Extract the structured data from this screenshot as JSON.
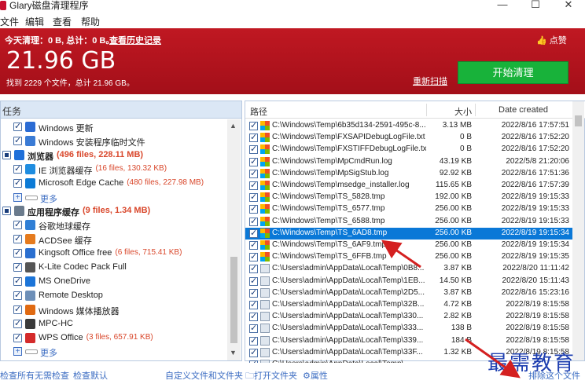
{
  "window": {
    "title": "Glary磁盘清理程序",
    "min_glyph": "—",
    "max_glyph": "☐",
    "close_glyph": "✕"
  },
  "menu": [
    "文件",
    "编辑",
    "查看",
    "帮助"
  ],
  "header": {
    "summary": "今天清理：0 B, 总计：0 B。",
    "history_link": "查看历史记录",
    "big_size": "21.96 GB",
    "found": "找到 2229 个文件，总计 21.96 GB。",
    "like": "点赞",
    "rescan": "重新扫描",
    "start_button": "开始清理"
  },
  "left_pane": {
    "header": "任务",
    "rows": [
      {
        "label": "Windows 更新",
        "count": "",
        "icon": "windows-icon",
        "color": "#2b6cd4",
        "indent": 1
      },
      {
        "label": "Windows 安装程序临时文件",
        "count": "",
        "icon": "windows-installer-icon",
        "color": "#3a7bd5",
        "indent": 1
      },
      {
        "label": "浏览器",
        "count": "(496 files, 228.11 MB)",
        "icon": "browser-icon",
        "color": "#1e6fd9",
        "indent": 0,
        "bold": true
      },
      {
        "label": "IE 浏览器缓存",
        "count": "(16 files, 130.32 KB)",
        "icon": "ie-icon",
        "color": "#1f8de0",
        "indent": 1
      },
      {
        "label": "Microsoft Edge Cache",
        "count": "(480 files, 227.98 MB)",
        "icon": "edge-icon",
        "color": "#0c7bd6",
        "indent": 1
      },
      {
        "label": "更多",
        "more": true,
        "indent": 1
      },
      {
        "label": "应用程序缓存",
        "count": "(9 files, 1.34 MB)",
        "icon": "apps-icon",
        "color": "#6b7b8c",
        "indent": 0,
        "bold": true
      },
      {
        "label": "谷歌地球缓存",
        "count": "",
        "icon": "google-earth-icon",
        "color": "#2f7fd6",
        "indent": 1
      },
      {
        "label": "ACDSee 缓存",
        "count": "",
        "icon": "acdsee-icon",
        "color": "#e57b1e",
        "indent": 1
      },
      {
        "label": "Kingsoft Office free",
        "count": "(6 files, 715.41 KB)",
        "icon": "kingsoft-icon",
        "color": "#2a6fd0",
        "indent": 1
      },
      {
        "label": "K-Lite Codec Pack Full",
        "count": "",
        "icon": "klite-icon",
        "color": "#555555",
        "indent": 1
      },
      {
        "label": "MS OneDrive",
        "count": "",
        "icon": "onedrive-icon",
        "color": "#1b74d8",
        "indent": 1
      },
      {
        "label": "Remote Desktop",
        "count": "",
        "icon": "remote-desktop-icon",
        "color": "#6d8fb8",
        "indent": 1
      },
      {
        "label": "Windows 媒体播放器",
        "count": "",
        "icon": "media-player-icon",
        "color": "#e06a12",
        "indent": 1
      },
      {
        "label": "MPC-HC",
        "count": "",
        "icon": "mpc-hc-icon",
        "color": "#3a3a3a",
        "indent": 1
      },
      {
        "label": "WPS Office",
        "count": "(3 files, 657.91 KB)",
        "icon": "wps-icon",
        "color": "#d42b2b",
        "indent": 1
      },
      {
        "label": "更多",
        "more": true,
        "indent": 1
      }
    ],
    "scroll_up": "▲",
    "scroll_down": "▼"
  },
  "right_pane": {
    "columns": {
      "path": "路径",
      "size": "大小",
      "date": "Date created"
    },
    "files": [
      {
        "path": "C:\\Windows\\Temp\\6b35d134-2591-495c-8...",
        "size": "3.13 MB",
        "date": "2022/8/16 17:57:51"
      },
      {
        "path": "C:\\Windows\\Temp\\FXSAPIDebugLogFile.txt",
        "size": "0 B",
        "date": "2022/8/16 17:52:20"
      },
      {
        "path": "C:\\Windows\\Temp\\FXSTIFFDebugLogFile.txt",
        "size": "0 B",
        "date": "2022/8/16 17:52:20"
      },
      {
        "path": "C:\\Windows\\Temp\\MpCmdRun.log",
        "size": "43.19 KB",
        "date": "2022/5/8 21:20:06"
      },
      {
        "path": "C:\\Windows\\Temp\\MpSigStub.log",
        "size": "92.92 KB",
        "date": "2022/8/16 17:51:36"
      },
      {
        "path": "C:\\Windows\\Temp\\msedge_installer.log",
        "size": "115.65 KB",
        "date": "2022/8/16 17:57:39"
      },
      {
        "path": "C:\\Windows\\Temp\\TS_5828.tmp",
        "size": "192.00 KB",
        "date": "2022/8/19 19:15:33"
      },
      {
        "path": "C:\\Windows\\Temp\\TS_6577.tmp",
        "size": "256.00 KB",
        "date": "2022/8/19 19:15:33"
      },
      {
        "path": "C:\\Windows\\Temp\\TS_6588.tmp",
        "size": "256.00 KB",
        "date": "2022/8/19 19:15:33"
      },
      {
        "path": "C:\\Windows\\Temp\\TS_6AD8.tmp",
        "size": "256.00 KB",
        "date": "2022/8/19 19:15:34",
        "selected": true
      },
      {
        "path": "C:\\Windows\\Temp\\TS_6AF9.tmp",
        "size": "256.00 KB",
        "date": "2022/8/19 19:15:34"
      },
      {
        "path": "C:\\Windows\\Temp\\TS_6FFB.tmp",
        "size": "256.00 KB",
        "date": "2022/8/19 19:15:35"
      },
      {
        "path": "C:\\Users\\admin\\AppData\\Local\\Temp\\0B8...",
        "size": "3.87 KB",
        "date": "2022/8/20 11:11:42"
      },
      {
        "path": "C:\\Users\\admin\\AppData\\Local\\Temp\\1EB...",
        "size": "14.50 KB",
        "date": "2022/8/20 15:11:43"
      },
      {
        "path": "C:\\Users\\admin\\AppData\\Local\\Temp\\2D5...",
        "size": "3.87 KB",
        "date": "2022/8/16 15:23:16"
      },
      {
        "path": "C:\\Users\\admin\\AppData\\Local\\Temp\\32B...",
        "size": "4.72 KB",
        "date": "2022/8/19 8:15:58"
      },
      {
        "path": "C:\\Users\\admin\\AppData\\Local\\Temp\\330...",
        "size": "2.82 KB",
        "date": "2022/8/19 8:15:58"
      },
      {
        "path": "C:\\Users\\admin\\AppData\\Local\\Temp\\333...",
        "size": "138 B",
        "date": "2022/8/19 8:15:58"
      },
      {
        "path": "C:\\Users\\admin\\AppData\\Local\\Temp\\339...",
        "size": "184 B",
        "date": "2022/8/19 8:15:58"
      },
      {
        "path": "C:\\Users\\admin\\AppData\\Local\\Temp\\33F...",
        "size": "1.32 KB",
        "date": "2022/8/19 8:15:58"
      },
      {
        "path": "C:\\Users\\admin\\AppData\\Local\\Temp\\...",
        "size": "",
        "date": ""
      }
    ]
  },
  "bottom": {
    "check_all": "检查所有",
    "no_check": "无需检查",
    "check_default": "检查默认",
    "custom_files": "自定义文件和文件夹",
    "open_folder": "打开文件夹",
    "properties": "属性",
    "exclude_file": "排除这个文件"
  },
  "watermark": "最需教育",
  "colors": {
    "header_red": "#b5141f",
    "start_green": "#18b23a",
    "link_blue": "#3b6cc2",
    "selected_row": "#0a78d7",
    "arrow_red": "#d42020"
  }
}
